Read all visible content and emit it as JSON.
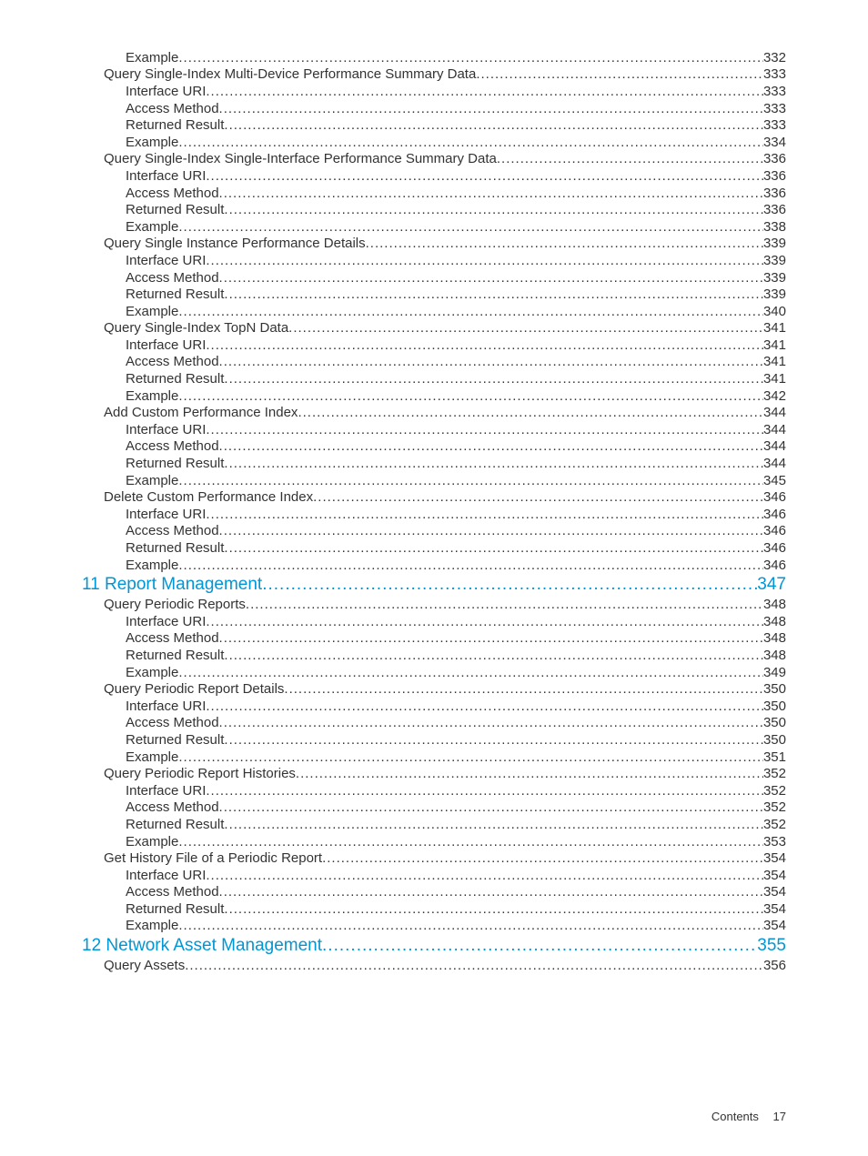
{
  "footer": {
    "label": "Contents",
    "page": "17"
  },
  "toc": [
    {
      "level": "lvl-2",
      "label": "Example",
      "page": "332"
    },
    {
      "level": "lvl-1",
      "label": "Query Single-Index Multi-Device Performance Summary Data",
      "page": "333"
    },
    {
      "level": "lvl-2",
      "label": "Interface URI",
      "page": "333"
    },
    {
      "level": "lvl-2",
      "label": "Access Method",
      "page": "333"
    },
    {
      "level": "lvl-2",
      "label": "Returned Result",
      "page": "333"
    },
    {
      "level": "lvl-2",
      "label": "Example",
      "page": "334"
    },
    {
      "level": "lvl-1",
      "label": "Query Single-Index Single-Interface Performance Summary Data",
      "page": "336"
    },
    {
      "level": "lvl-2",
      "label": "Interface URI",
      "page": "336"
    },
    {
      "level": "lvl-2",
      "label": "Access Method",
      "page": "336"
    },
    {
      "level": "lvl-2",
      "label": "Returned Result",
      "page": "336"
    },
    {
      "level": "lvl-2",
      "label": "Example",
      "page": "338"
    },
    {
      "level": "lvl-1",
      "label": "Query Single Instance Performance Details",
      "page": "339"
    },
    {
      "level": "lvl-2",
      "label": "Interface URI",
      "page": "339"
    },
    {
      "level": "lvl-2",
      "label": "Access Method",
      "page": "339"
    },
    {
      "level": "lvl-2",
      "label": "Returned Result",
      "page": "339"
    },
    {
      "level": "lvl-2",
      "label": "Example",
      "page": "340"
    },
    {
      "level": "lvl-1",
      "label": "Query Single-Index TopN Data",
      "page": "341"
    },
    {
      "level": "lvl-2",
      "label": "Interface URI",
      "page": "341"
    },
    {
      "level": "lvl-2",
      "label": "Access Method",
      "page": "341"
    },
    {
      "level": "lvl-2",
      "label": "Returned Result",
      "page": "341"
    },
    {
      "level": "lvl-2",
      "label": "Example",
      "page": "342"
    },
    {
      "level": "lvl-1",
      "label": "Add Custom Performance Index",
      "page": "344"
    },
    {
      "level": "lvl-2",
      "label": "Interface URI",
      "page": "344"
    },
    {
      "level": "lvl-2",
      "label": "Access Method",
      "page": "344"
    },
    {
      "level": "lvl-2",
      "label": "Returned Result",
      "page": "344"
    },
    {
      "level": "lvl-2",
      "label": "Example",
      "page": "345"
    },
    {
      "level": "lvl-1",
      "label": "Delete Custom Performance Index",
      "page": "346"
    },
    {
      "level": "lvl-2",
      "label": "Interface URI",
      "page": "346"
    },
    {
      "level": "lvl-2",
      "label": "Access Method",
      "page": "346"
    },
    {
      "level": "lvl-2",
      "label": "Returned Result",
      "page": "346"
    },
    {
      "level": "lvl-2",
      "label": "Example",
      "page": "346"
    },
    {
      "level": "lvl-chapter",
      "label": "11 Report Management",
      "page": "347"
    },
    {
      "level": "lvl-1",
      "label": "Query Periodic Reports",
      "page": "348"
    },
    {
      "level": "lvl-2",
      "label": "Interface URI",
      "page": "348"
    },
    {
      "level": "lvl-2",
      "label": "Access Method",
      "page": "348"
    },
    {
      "level": "lvl-2",
      "label": "Returned Result",
      "page": "348"
    },
    {
      "level": "lvl-2",
      "label": "Example",
      "page": "349"
    },
    {
      "level": "lvl-1",
      "label": "Query Periodic Report Details",
      "page": "350"
    },
    {
      "level": "lvl-2",
      "label": "Interface URI",
      "page": "350"
    },
    {
      "level": "lvl-2",
      "label": "Access Method",
      "page": "350"
    },
    {
      "level": "lvl-2",
      "label": "Returned Result",
      "page": "350"
    },
    {
      "level": "lvl-2",
      "label": "Example",
      "page": "351"
    },
    {
      "level": "lvl-1",
      "label": "Query Periodic Report Histories",
      "page": "352"
    },
    {
      "level": "lvl-2",
      "label": "Interface URI",
      "page": "352"
    },
    {
      "level": "lvl-2",
      "label": "Access Method",
      "page": "352"
    },
    {
      "level": "lvl-2",
      "label": "Returned Result",
      "page": "352"
    },
    {
      "level": "lvl-2",
      "label": "Example",
      "page": "353"
    },
    {
      "level": "lvl-1",
      "label": "Get History File of a Periodic Report",
      "page": "354"
    },
    {
      "level": "lvl-2",
      "label": "Interface URI",
      "page": "354"
    },
    {
      "level": "lvl-2",
      "label": "Access Method",
      "page": "354"
    },
    {
      "level": "lvl-2",
      "label": "Returned Result",
      "page": "354"
    },
    {
      "level": "lvl-2",
      "label": "Example",
      "page": "354"
    },
    {
      "level": "lvl-chapter",
      "label": "12 Network Asset Management",
      "page": "355"
    },
    {
      "level": "lvl-1",
      "label": "Query Assets",
      "page": "356"
    }
  ]
}
